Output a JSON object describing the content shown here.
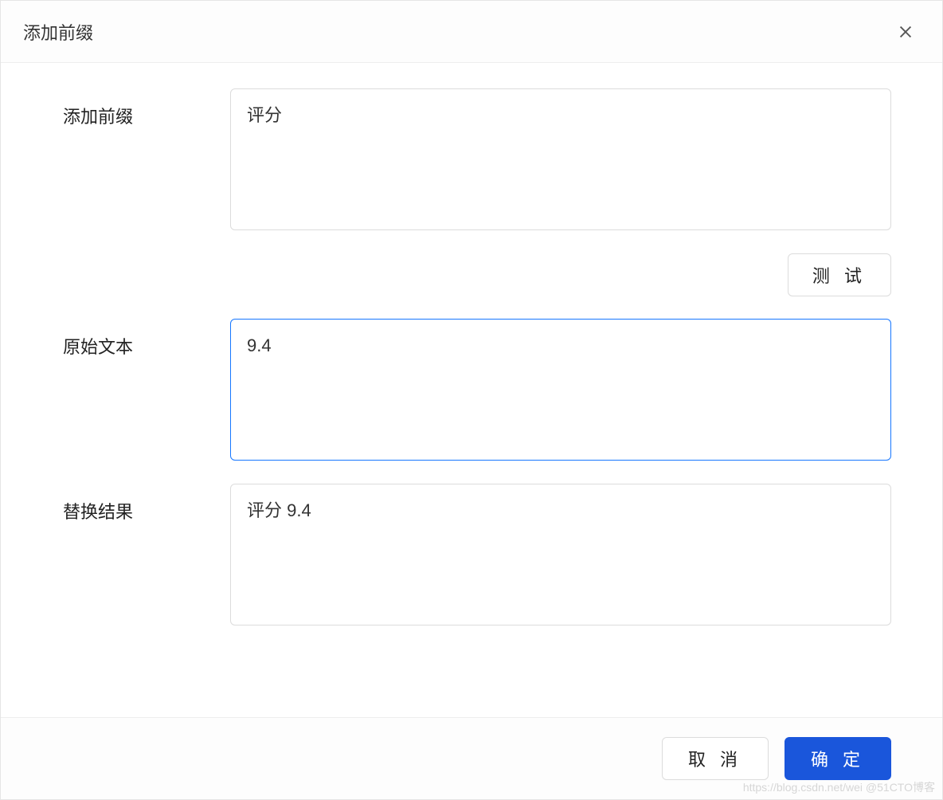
{
  "dialog": {
    "title": "添加前缀",
    "fields": {
      "prefix": {
        "label": "添加前缀",
        "value": "评分"
      },
      "original": {
        "label": "原始文本",
        "value": "9.4"
      },
      "result": {
        "label": "替换结果",
        "value": "评分 9.4"
      }
    },
    "buttons": {
      "test": "测 试",
      "cancel": "取 消",
      "confirm": "确 定"
    }
  },
  "watermark": "https://blog.csdn.net/wei @51CTO博客"
}
